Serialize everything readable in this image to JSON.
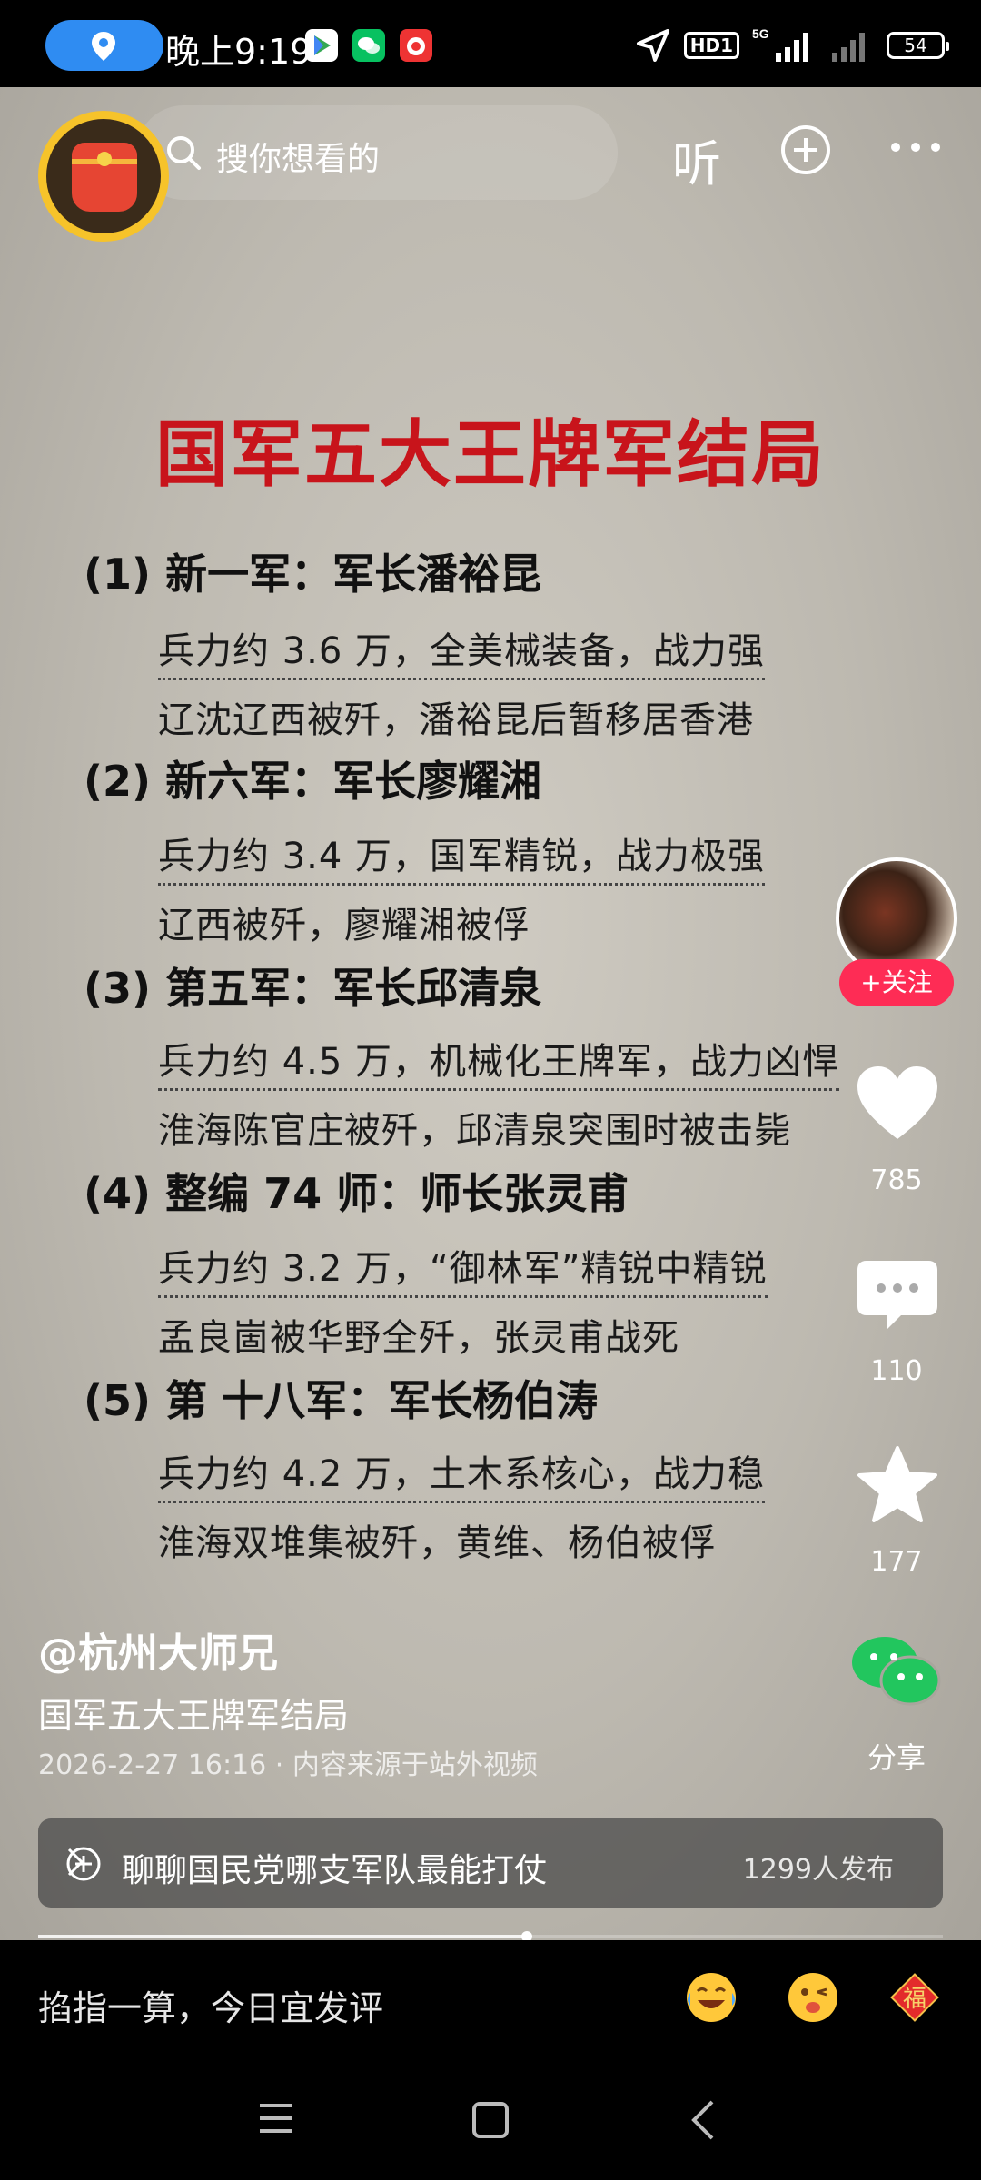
{
  "status_bar": {
    "time": "晚上9:19",
    "network_badge": "HD1",
    "network_type": "5G",
    "battery": "54",
    "location_pill_color": "#2f8cf2"
  },
  "top_bar": {
    "search_placeholder": "搜你想看的",
    "listen_label": "听",
    "icons": [
      "red-packet-icon",
      "search-icon",
      "add-circle-icon",
      "more-icon"
    ]
  },
  "video_content": {
    "title": "国军五大王牌军结局",
    "entries": [
      {
        "head": "(1) 新一军：军长潘裕昆",
        "line1": "兵力约 3.6 万，全美械装备，战力强",
        "line2": "辽沈辽西被歼，潘裕昆后暂移居香港"
      },
      {
        "head": "(2) 新六军：军长廖耀湘",
        "line1": "兵力约 3.4 万，国军精锐，战力极强",
        "line2": "辽西被歼，廖耀湘被俘"
      },
      {
        "head": "(3) 第五军：军长邱清泉",
        "line1": "兵力约 4.5 万，机械化王牌军，战力凶悍",
        "line2": "淮海陈官庄被歼，邱清泉突围时被击毙"
      },
      {
        "head": "(4) 整编 74 师：师长张灵甫",
        "line1": "兵力约 3.2 万，“御林军”精锐中精锐",
        "line2": "孟良崮被华野全歼，张灵甫战死"
      },
      {
        "head": "(5) 第 十八军：军长杨伯涛",
        "line1": "兵力约 4.2 万，土木系核心，战力稳",
        "line2": "淮海双堆集被歼，黄维、杨伯被俘"
      }
    ]
  },
  "actions": {
    "follow_label": "+关注",
    "likes": "785",
    "comments": "110",
    "favorites": "177",
    "share_label": "分享",
    "accent_color": "#fe2c55"
  },
  "post_info": {
    "author": "@杭州大师兄",
    "description": "国军五大王牌军结局",
    "meta": "2026-2-27 16:16 · 内容来源于站外视频"
  },
  "topic": {
    "text": "聊聊国民党哪支军队最能打仗",
    "count": "1299人发布"
  },
  "playback": {
    "progress_fraction": 0.54
  },
  "comment_bar": {
    "placeholder": "掐指一算，今日宜发评",
    "emojis": [
      "laughing-crying-emoji",
      "winking-tongue-emoji",
      "fu-red-diamond-emoji"
    ]
  },
  "nav_bar": {
    "buttons": [
      "menu",
      "home",
      "back"
    ]
  }
}
